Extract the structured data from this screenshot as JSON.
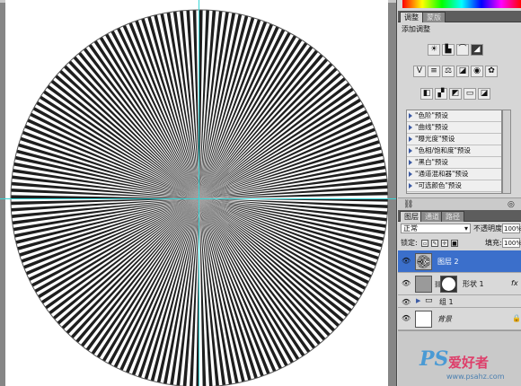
{
  "adjustments_panel": {
    "tabs": [
      "调整",
      "蒙版"
    ],
    "title": "添加调整",
    "icon_rows": [
      [
        "brightness-contrast-icon",
        "levels-icon",
        "curves-icon",
        "exposure-icon"
      ],
      [
        "vibrance-icon",
        "hue-saturation-icon",
        "color-balance-icon",
        "black-white-icon",
        "photo-filter-icon",
        "channel-mixer-icon"
      ],
      [
        "invert-icon",
        "posterize-icon",
        "threshold-icon",
        "gradient-map-icon",
        "selective-color-icon"
      ]
    ],
    "presets": [
      "\"色阶\"预设",
      "\"曲线\"预设",
      "\"曝光度\"预设",
      "\"色相/饱和度\"预设",
      "\"黑白\"预设",
      "\"通道混和器\"预设",
      "\"可选颜色\"预设"
    ]
  },
  "layers_panel": {
    "tabs": [
      "图层",
      "通道",
      "路径"
    ],
    "blend_mode": "正常",
    "opacity_label": "不透明度:",
    "opacity_value": "100%",
    "lock_label": "锁定:",
    "fill_label": "填充:",
    "fill_value": "100%",
    "layers": [
      {
        "name": "图层 2",
        "selected": true
      },
      {
        "name": "形状 1",
        "selected": false,
        "fx": "fx"
      },
      {
        "name": "组 1",
        "selected": false
      },
      {
        "name": "背景",
        "selected": false
      }
    ]
  },
  "watermark": {
    "logo": "PS",
    "text": "爱好者",
    "url": "www.psahz.com"
  },
  "colors": {
    "selection_blue": "#3b6fcb",
    "guide_cyan": "#38d6d6"
  }
}
